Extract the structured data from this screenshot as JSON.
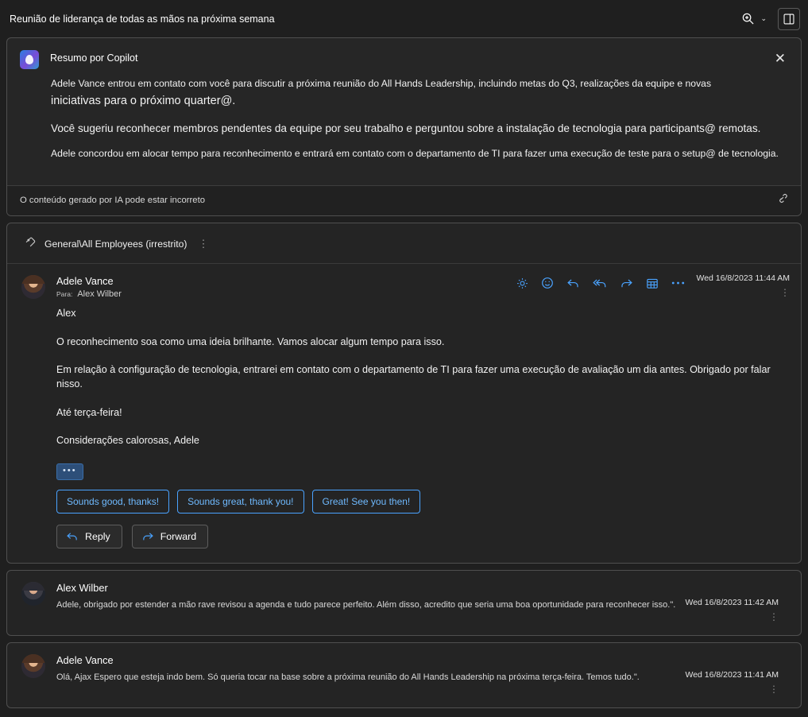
{
  "titlebar": {
    "subject": "Reunião de liderança de todas as mãos na próxima semana",
    "zoom_icon": "zoom-in-icon",
    "zoom_caret": "⌄",
    "window_icon": "open-in-new-window-icon"
  },
  "copilot": {
    "title": "Resumo por Copilot",
    "close_label": "✕",
    "paragraphs": [
      "Adele Vance entrou em contato com você para discutir a próxima reunião do All Hands Leadership, incluindo metas do Q3, realizações da equipe e novas",
      "iniciativas para o próximo quarter@.",
      "Você sugeriu reconhecer membros pendentes da equipe por seu trabalho e perguntou sobre a instalação de tecnologia para participants@ remotas.",
      "Adele concordou em alocar tempo para reconhecimento e entrará em contato com o departamento de TI para fazer uma execução de teste para o setup@ de tecnologia."
    ],
    "disclaimer": "O conteúdo gerado por IA pode estar incorreto",
    "feedback_icon": "feedback-link-icon"
  },
  "conversation": {
    "sensitivity_label": "General\\All Employees (irrestrito)",
    "sensitivity_icon": "sensitivity-label-icon",
    "overflow_icon": "more-vertical-icon"
  },
  "message": {
    "sender": "Adele Vance",
    "to_keyword": "Para:",
    "to_recipient": "Alex Wilber",
    "timestamp": "Wed 16/8/2023 11:44 AM",
    "actions": [
      {
        "name": "highlight-icon",
        "glyph": "☀"
      },
      {
        "name": "emoji-reaction-icon",
        "glyph": "☺"
      },
      {
        "name": "reply-icon",
        "glyph": "↶"
      },
      {
        "name": "reply-all-icon",
        "glyph": "↶"
      },
      {
        "name": "forward-icon",
        "glyph": "↷"
      },
      {
        "name": "calendar-icon",
        "glyph": "▦"
      },
      {
        "name": "more-actions-icon",
        "glyph": "⋯"
      }
    ],
    "body": [
      "Alex",
      "O reconhecimento soa como uma ideia brilhante. Vamos alocar algum tempo para isso.",
      "Em relação à configuração de tecnologia, entrarei em contato com o departamento de TI para fazer uma execução de avaliação um dia antes. Obrigado por falar nisso.",
      "Até terça-feira!",
      "Considerações calorosas, Adele"
    ],
    "expand_chip": "•••",
    "suggestions": [
      "Sounds good, thanks!",
      "Sounds great, thank you!",
      "Great! See you then!"
    ],
    "reply_button": "Reply",
    "forward_button": "Forward"
  },
  "collapsed_messages": [
    {
      "sender": "Alex Wilber",
      "preview": "Adele, obrigado por estender a mão rave revisou a agenda e tudo parece perfeito. Além disso, acredito que seria uma boa oportunidade para reconhecer isso.\".",
      "timestamp": "Wed 16/8/2023 11:42 AM"
    },
    {
      "sender": "Adele Vance",
      "preview": "Olá, Ajax Espero que esteja indo bem. Só queria tocar na base sobre a próxima reunião do All Hands Leadership na próxima terça-feira. Temos tudo.\".",
      "timestamp": "Wed 16/8/2023 11:41 AM"
    }
  ]
}
